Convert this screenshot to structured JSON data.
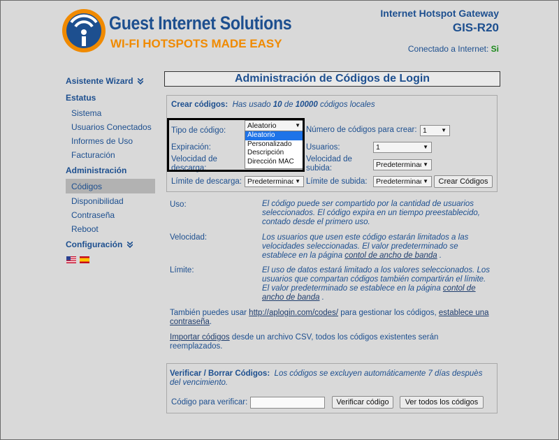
{
  "header": {
    "logo_title": "Guest Internet Solutions",
    "logo_tagline": "WI-FI HOTSPOTS MADE EASY",
    "gateway_title": "Internet Hotspot Gateway",
    "gateway_model": "GIS-R20",
    "connected_label": "Conectado a Internet:",
    "connected_value": "Si",
    "brand_colors": {
      "blue": "#1d4f8f",
      "orange": "#f08a00"
    }
  },
  "sidebar": {
    "wizard": "Asistente Wizard",
    "status_head": "Estatus",
    "status_items": [
      "Sistema",
      "Usuarios Conectados",
      "Informes de Uso",
      "Facturación"
    ],
    "admin_head": "Administración",
    "admin_items": [
      "Códigos",
      "Disponibilidad",
      "Contraseña",
      "Reboot"
    ],
    "config_head": "Configuración"
  },
  "main": {
    "title": "Administración de Códigos de Login",
    "create": {
      "heading": "Crear códigos:",
      "used_pre": "Has usado",
      "used_count": "10",
      "used_mid": "de",
      "used_total": "10000",
      "used_post": "códigos locales",
      "type_label": "Tipo de código:",
      "type_value": "Aleatorio",
      "type_options": [
        "Aleatorio",
        "Personalizado",
        "Descripción",
        "Dirección MAC"
      ],
      "count_label": "Número de códigos para crear:",
      "count_value": "1",
      "expiration_label": "Expiración:",
      "users_label": "Usuarios:",
      "users_value": "1",
      "down_speed_label_1": "Velocidad de",
      "down_speed_label_2": "descarga:",
      "up_speed_label_1": "Velocidad de",
      "up_speed_label_2": "subida:",
      "up_speed_value": "Predeterminado",
      "down_limit_label": "Límite de descarga:",
      "down_limit_value": "Predeterminado",
      "up_limit_label": "Límite de subida:",
      "up_limit_value": "Predeterminado",
      "create_button": "Crear Códigos"
    },
    "info": {
      "use_label": "Uso:",
      "use_lines": [
        "El código puede ser compartido por la cantidad de usuarios",
        "seleccionados. El código expira en un tiempo preestablecido,",
        "contado desde el primero uso."
      ],
      "speed_label": "Velocidad:",
      "speed_lines": [
        "Los usuarios que usen este código estarán limitados a las",
        "velocidades seleccionadas. El valor predeterminado se",
        "establece en la página"
      ],
      "speed_link": "contol de ancho de banda",
      "speed_end": ".",
      "limit_label": "Límite:",
      "limit_lines": [
        "El uso de datos estará limitado a los valores seleccionados. Los",
        "usuarios que compartan códigos también compartirán el límite.",
        "El valor predeterminado se establece en la página"
      ],
      "limit_link_1": "contol de",
      "limit_link_2": "ancho de banda",
      "limit_end": ".",
      "also_pre": "También puedes usar",
      "also_link": "http://aplogin.com/codes/",
      "also_mid": "para gestionar los códigos,",
      "also_link2_1": "establece una",
      "also_link2_2": "contraseña",
      "also_end": ".",
      "import_link": "Importar códigos",
      "import_rest": "desde un archivo CSV, todos los códigos existentes serán",
      "import_rest2": "reemplazados."
    },
    "verify": {
      "heading": "Verificar / Borrar Códigos:",
      "note_1": "Los códigos se excluyen automáticamente 7 días despuès",
      "note_2": "del vencimiento.",
      "code_label": "Código para verificar:",
      "code_value": "",
      "verify_button": "Verificar código",
      "all_button": "Ver todos los códigos"
    }
  }
}
